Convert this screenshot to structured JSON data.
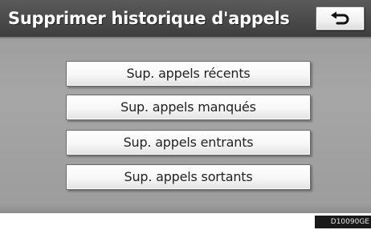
{
  "header": {
    "title": "Supprimer historique d'appels",
    "back_icon": "return-arrow-icon"
  },
  "menu": {
    "items": [
      {
        "label": "Sup. appels récents"
      },
      {
        "label": "Sup. appels manqués"
      },
      {
        "label": "Sup. appels entrants"
      },
      {
        "label": "Sup. appels sortants"
      }
    ]
  },
  "footer": {
    "image_code": "D10090GE"
  },
  "colors": {
    "header_bg": "#4a4a4a",
    "screen_bg": "#a3a3a3",
    "button_bg": "#f7f7f7",
    "button_text": "#222222"
  }
}
